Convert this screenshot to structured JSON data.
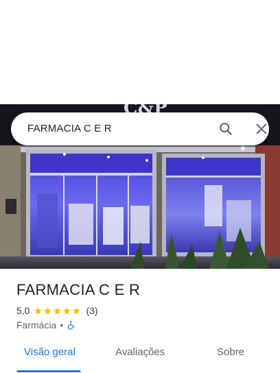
{
  "search": {
    "query": "FARMACIA C E R"
  },
  "place": {
    "name": "FARMACIA C E R",
    "rating": "5,0",
    "stars": 5,
    "review_count": "(3)",
    "category": "Farmácia",
    "separator": "•"
  },
  "tabs": [
    {
      "label": "Visão geral",
      "active": true
    },
    {
      "label": "Avaliações",
      "active": false
    },
    {
      "label": "Sobre",
      "active": false
    }
  ],
  "photo": {
    "storefront_sign": "C&P"
  },
  "colors": {
    "accent": "#1a73e8",
    "star": "#fbbc04",
    "text_primary": "#202124",
    "text_secondary": "#5f6368"
  }
}
